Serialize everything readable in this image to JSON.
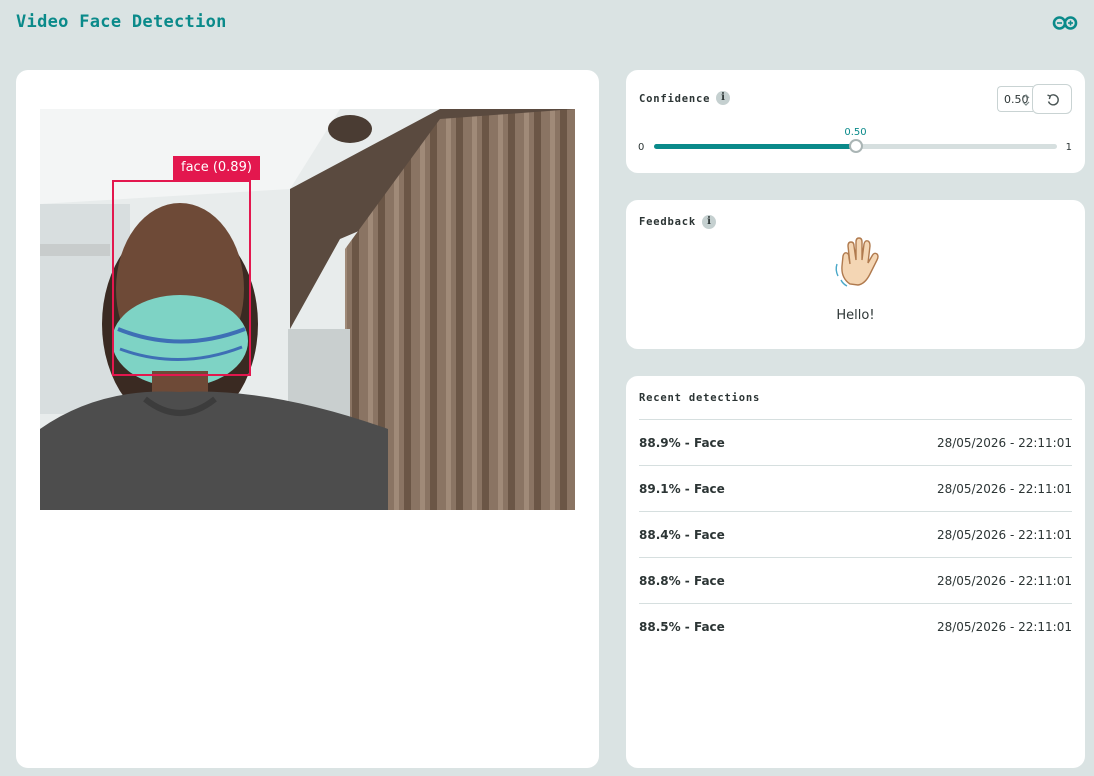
{
  "app": {
    "title": "Video Face Detection",
    "accent_color": "#0a8a8a",
    "logo_icon": "infinity-logo-icon"
  },
  "video": {
    "detection": {
      "label": "face (0.89)",
      "class": "face",
      "score": 0.89,
      "box_color": "#e3174e"
    }
  },
  "confidence": {
    "title": "Confidence",
    "info_icon": "info-icon",
    "value_text": "0.50",
    "value": 0.5,
    "min_label": "0",
    "max_label": "1",
    "reset_icon": "reset-icon"
  },
  "feedback": {
    "title": "Feedback",
    "info_icon": "info-icon",
    "icon": "waving-hand-icon",
    "message": "Hello!"
  },
  "recent": {
    "title": "Recent detections",
    "items": [
      {
        "label": "88.9% - Face",
        "time": "28/05/2026 - 22:11:01"
      },
      {
        "label": "89.1% - Face",
        "time": "28/05/2026 - 22:11:01"
      },
      {
        "label": "88.4% - Face",
        "time": "28/05/2026 - 22:11:01"
      },
      {
        "label": "88.8% - Face",
        "time": "28/05/2026 - 22:11:01"
      },
      {
        "label": "88.5% - Face",
        "time": "28/05/2026 - 22:11:01"
      }
    ]
  }
}
